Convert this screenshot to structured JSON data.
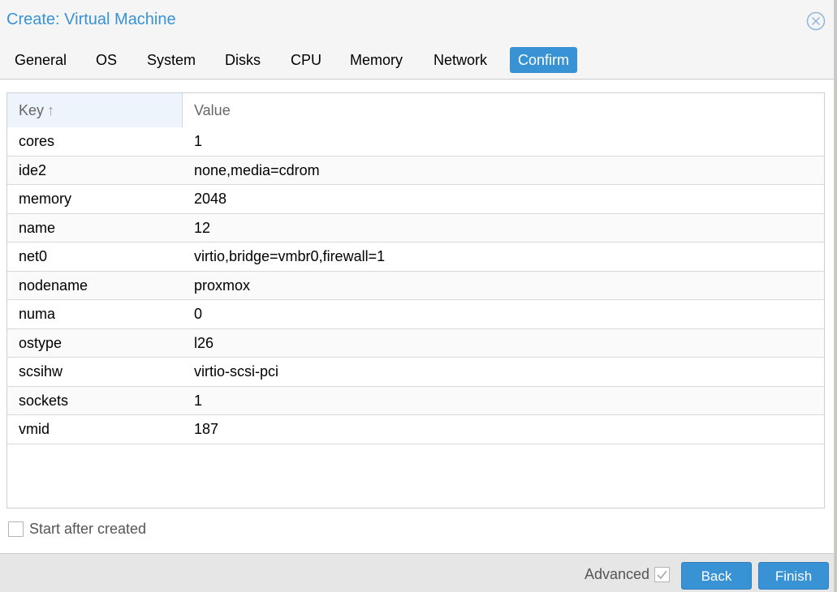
{
  "window": {
    "title": "Create: Virtual Machine",
    "close_icon": "close-circle-icon"
  },
  "tabs": [
    {
      "label": "General",
      "active": false
    },
    {
      "label": "OS",
      "active": false
    },
    {
      "label": "System",
      "active": false
    },
    {
      "label": "Disks",
      "active": false
    },
    {
      "label": "CPU",
      "active": false
    },
    {
      "label": "Memory",
      "active": false
    },
    {
      "label": "Network",
      "active": false
    },
    {
      "label": "Confirm",
      "active": true
    }
  ],
  "grid": {
    "columns": {
      "key": "Key",
      "value": "Value"
    },
    "sort_icon": "↑",
    "rows": [
      {
        "key": "cores",
        "value": "1"
      },
      {
        "key": "ide2",
        "value": "none,media=cdrom"
      },
      {
        "key": "memory",
        "value": "2048"
      },
      {
        "key": "name",
        "value": "12"
      },
      {
        "key": "net0",
        "value": "virtio,bridge=vmbr0,firewall=1"
      },
      {
        "key": "nodename",
        "value": "proxmox"
      },
      {
        "key": "numa",
        "value": "0"
      },
      {
        "key": "ostype",
        "value": "l26"
      },
      {
        "key": "scsihw",
        "value": "virtio-scsi-pci"
      },
      {
        "key": "sockets",
        "value": "1"
      },
      {
        "key": "vmid",
        "value": "187"
      }
    ]
  },
  "start_after_created": {
    "label": "Start after created",
    "checked": false
  },
  "footer": {
    "advanced_label": "Advanced",
    "advanced_checked": true,
    "back_label": "Back",
    "finish_label": "Finish"
  }
}
